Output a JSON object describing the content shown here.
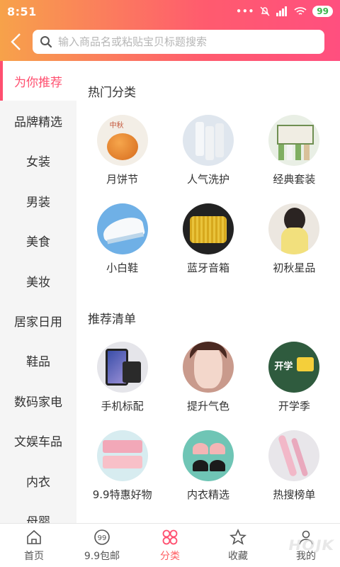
{
  "status_bar": {
    "time": "8:51",
    "battery": "99"
  },
  "header": {
    "search_placeholder": "输入商品名或粘贴宝贝标题搜索"
  },
  "sidebar": {
    "items": [
      {
        "label": "为你推荐",
        "active": true
      },
      {
        "label": "品牌精选"
      },
      {
        "label": "女装"
      },
      {
        "label": "男装"
      },
      {
        "label": "美食"
      },
      {
        "label": "美妆"
      },
      {
        "label": "居家日用"
      },
      {
        "label": "鞋品"
      },
      {
        "label": "数码家电"
      },
      {
        "label": "文娱车品"
      },
      {
        "label": "内衣"
      },
      {
        "label": "母婴"
      }
    ]
  },
  "sections": [
    {
      "title": "热门分类",
      "items": [
        {
          "label": "月饼节",
          "icon": "mooncake-image"
        },
        {
          "label": "人气洗护",
          "icon": "bath-products-image"
        },
        {
          "label": "经典套装",
          "icon": "skincare-set-image"
        },
        {
          "label": "小白鞋",
          "icon": "white-sneaker-image"
        },
        {
          "label": "蓝牙音箱",
          "icon": "bluetooth-speaker-image"
        },
        {
          "label": "初秋星品",
          "icon": "autumn-fashion-image"
        }
      ]
    },
    {
      "title": "推荐清单",
      "items": [
        {
          "label": "手机标配",
          "icon": "phone-accessories-image"
        },
        {
          "label": "提升气色",
          "icon": "makeup-face-image"
        },
        {
          "label": "开学季",
          "icon": "back-to-school-image"
        },
        {
          "label": "9.9特惠好物",
          "icon": "bargain-goods-image"
        },
        {
          "label": "内衣精选",
          "icon": "underwear-image"
        },
        {
          "label": "热搜榜单",
          "icon": "hot-search-image"
        }
      ]
    }
  ],
  "bottom_nav": [
    {
      "label": "首页",
      "icon": "home-icon"
    },
    {
      "label": "9.9包邮",
      "icon": "coupon-99-icon"
    },
    {
      "label": "分类",
      "icon": "category-icon",
      "active": true
    },
    {
      "label": "收藏",
      "icon": "star-icon"
    },
    {
      "label": "我的",
      "icon": "user-icon"
    }
  ],
  "colors": {
    "accent": "#ff4f6f",
    "header_start": "#f7a24a",
    "header_end": "#ff4f7f",
    "sidebar_bg": "#f5f5f5"
  }
}
